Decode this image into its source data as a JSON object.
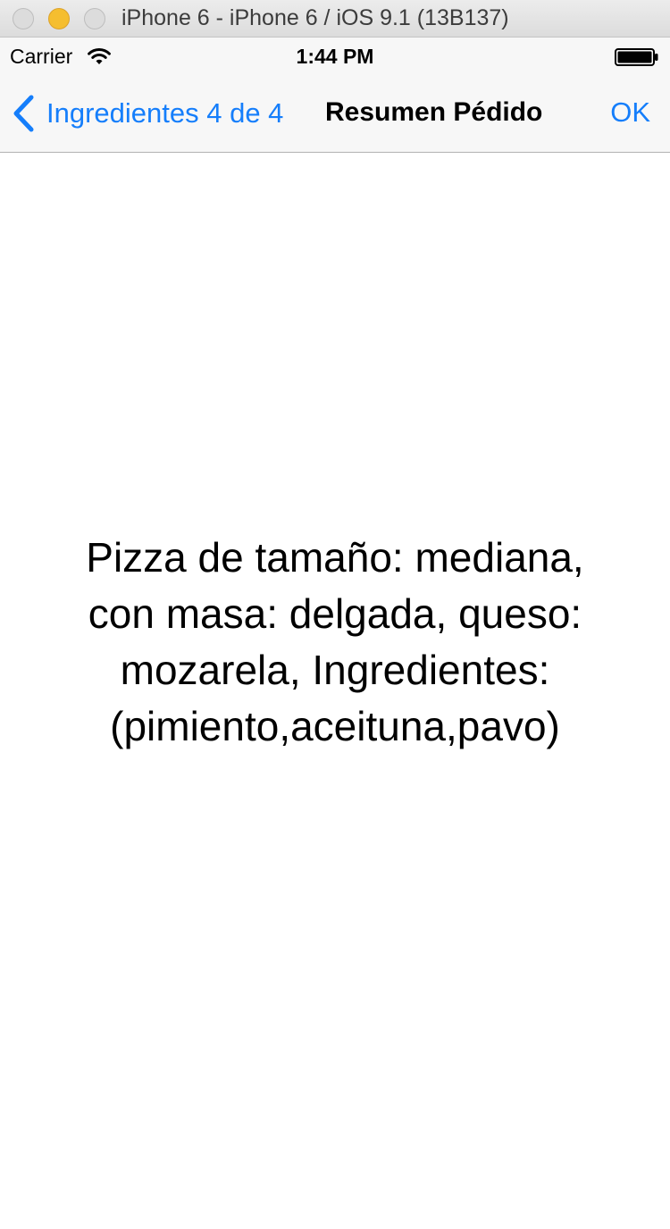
{
  "window": {
    "title": "iPhone 6 - iPhone 6 / iOS 9.1 (13B137)"
  },
  "status_bar": {
    "carrier": "Carrier",
    "time": "1:44 PM",
    "wifi_icon": "wifi-icon",
    "battery_icon": "battery-icon"
  },
  "nav": {
    "back_label": "Ingredientes 4 de 4",
    "back_icon": "chevron-left-icon",
    "title": "Resumen Pédido",
    "ok_label": "OK",
    "accent_color": "#157efb"
  },
  "content": {
    "summary": "Pizza de tamaño: mediana,\ncon masa: delgada,  queso:\nmozarela, Ingredientes:\n(pimiento,aceituna,pavo)"
  }
}
